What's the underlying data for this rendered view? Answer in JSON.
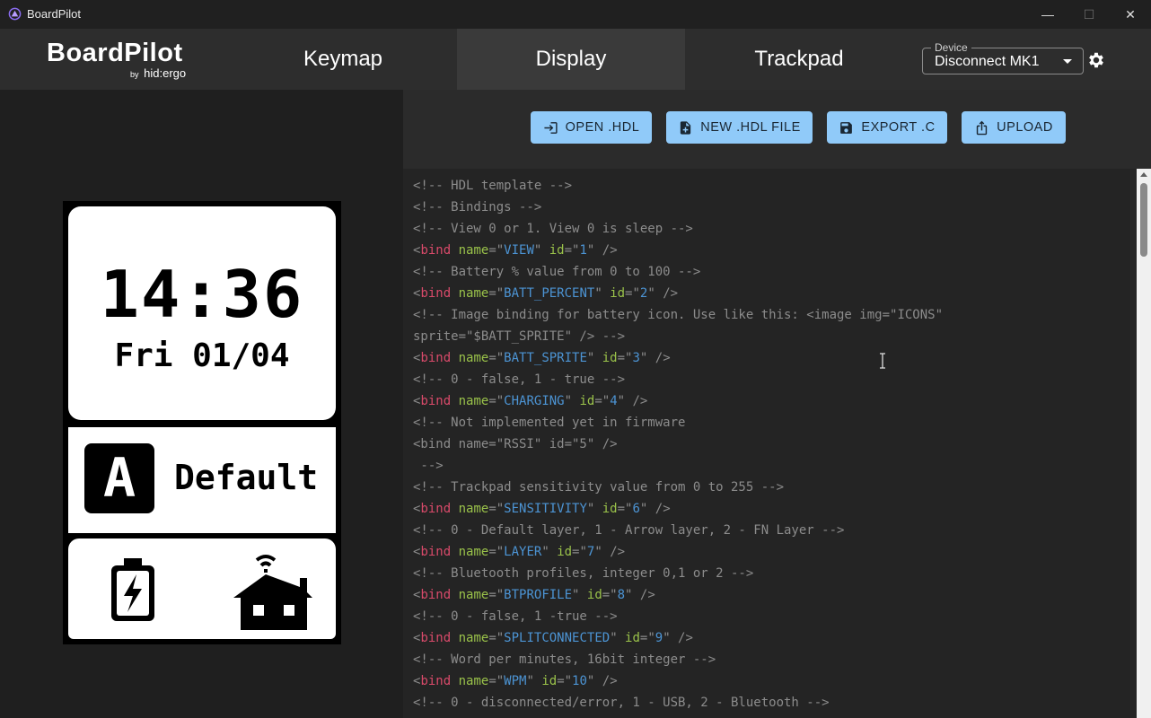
{
  "window": {
    "title": "BoardPilot",
    "minimize_glyph": "—",
    "maximize_glyph": "☐",
    "close_glyph": "✕"
  },
  "brand": {
    "name": "BoardPilot",
    "by": "by",
    "company": "hid:ergo"
  },
  "tabs": [
    {
      "label": "Keymap",
      "active": false
    },
    {
      "label": "Display",
      "active": true
    },
    {
      "label": "Trackpad",
      "active": false
    }
  ],
  "device": {
    "label": "Device",
    "value": "Disconnect MK1"
  },
  "toolbar": {
    "open_label": "OPEN .HDL",
    "new_label": "NEW .HDL FILE",
    "export_label": "EXPORT .C",
    "upload_label": "UPLOAD"
  },
  "preview": {
    "time": "14:36",
    "date": "Fri 01/04",
    "layer_letter": "A",
    "layer_name": "Default"
  },
  "colors": {
    "accent": "#90caf9",
    "tag": "#d94a6a",
    "attr": "#9ac24a",
    "string": "#4c94d4",
    "comment": "#8c8c8c"
  },
  "code_lines": [
    [
      [
        "c",
        "<!-- HDL template -->"
      ]
    ],
    [
      [
        "c",
        "<!-- Bindings -->"
      ]
    ],
    [
      [
        "c",
        "<!-- View 0 or 1. View 0 is sleep -->"
      ]
    ],
    [
      [
        "p",
        "<"
      ],
      [
        "t",
        "bind"
      ],
      [
        "p",
        " "
      ],
      [
        "a",
        "name"
      ],
      [
        "p",
        "=\""
      ],
      [
        "s",
        "VIEW"
      ],
      [
        "p",
        "\" "
      ],
      [
        "a",
        "id"
      ],
      [
        "p",
        "=\""
      ],
      [
        "s",
        "1"
      ],
      [
        "p",
        "\" />"
      ]
    ],
    [
      [
        "c",
        "<!-- Battery % value from 0 to 100 -->"
      ]
    ],
    [
      [
        "p",
        "<"
      ],
      [
        "t",
        "bind"
      ],
      [
        "p",
        " "
      ],
      [
        "a",
        "name"
      ],
      [
        "p",
        "=\""
      ],
      [
        "s",
        "BATT_PERCENT"
      ],
      [
        "p",
        "\" "
      ],
      [
        "a",
        "id"
      ],
      [
        "p",
        "=\""
      ],
      [
        "s",
        "2"
      ],
      [
        "p",
        "\" />"
      ]
    ],
    [
      [
        "c",
        "<!-- Image binding for battery icon. Use like this: <image img=\"ICONS\""
      ]
    ],
    [
      [
        "c",
        "sprite=\"$BATT_SPRITE\" /> -->"
      ]
    ],
    [
      [
        "p",
        "<"
      ],
      [
        "t",
        "bind"
      ],
      [
        "p",
        " "
      ],
      [
        "a",
        "name"
      ],
      [
        "p",
        "=\""
      ],
      [
        "s",
        "BATT_SPRITE"
      ],
      [
        "p",
        "\" "
      ],
      [
        "a",
        "id"
      ],
      [
        "p",
        "=\""
      ],
      [
        "s",
        "3"
      ],
      [
        "p",
        "\" />"
      ]
    ],
    [
      [
        "c",
        "<!-- 0 - false, 1 - true -->"
      ]
    ],
    [
      [
        "p",
        "<"
      ],
      [
        "t",
        "bind"
      ],
      [
        "p",
        " "
      ],
      [
        "a",
        "name"
      ],
      [
        "p",
        "=\""
      ],
      [
        "s",
        "CHARGING"
      ],
      [
        "p",
        "\" "
      ],
      [
        "a",
        "id"
      ],
      [
        "p",
        "=\""
      ],
      [
        "s",
        "4"
      ],
      [
        "p",
        "\" />"
      ]
    ],
    [
      [
        "c",
        "<!-- Not implemented yet in firmware"
      ]
    ],
    [
      [
        "c",
        "<bind name=\"RSSI\" id=\"5\" />"
      ]
    ],
    [
      [
        "c",
        " -->"
      ]
    ],
    [
      [
        "c",
        "<!-- Trackpad sensitivity value from 0 to 255 -->"
      ]
    ],
    [
      [
        "p",
        "<"
      ],
      [
        "t",
        "bind"
      ],
      [
        "p",
        " "
      ],
      [
        "a",
        "name"
      ],
      [
        "p",
        "=\""
      ],
      [
        "s",
        "SENSITIVITY"
      ],
      [
        "p",
        "\" "
      ],
      [
        "a",
        "id"
      ],
      [
        "p",
        "=\""
      ],
      [
        "s",
        "6"
      ],
      [
        "p",
        "\" />"
      ]
    ],
    [
      [
        "c",
        "<!-- 0 - Default layer, 1 - Arrow layer, 2 - FN Layer -->"
      ]
    ],
    [
      [
        "p",
        "<"
      ],
      [
        "t",
        "bind"
      ],
      [
        "p",
        " "
      ],
      [
        "a",
        "name"
      ],
      [
        "p",
        "=\""
      ],
      [
        "s",
        "LAYER"
      ],
      [
        "p",
        "\" "
      ],
      [
        "a",
        "id"
      ],
      [
        "p",
        "=\""
      ],
      [
        "s",
        "7"
      ],
      [
        "p",
        "\" />"
      ]
    ],
    [
      [
        "c",
        "<!-- Bluetooth profiles, integer 0,1 or 2 -->"
      ]
    ],
    [
      [
        "p",
        "<"
      ],
      [
        "t",
        "bind"
      ],
      [
        "p",
        " "
      ],
      [
        "a",
        "name"
      ],
      [
        "p",
        "=\""
      ],
      [
        "s",
        "BTPROFILE"
      ],
      [
        "p",
        "\" "
      ],
      [
        "a",
        "id"
      ],
      [
        "p",
        "=\""
      ],
      [
        "s",
        "8"
      ],
      [
        "p",
        "\" />"
      ]
    ],
    [
      [
        "c",
        "<!-- 0 - false, 1 -true -->"
      ]
    ],
    [
      [
        "p",
        "<"
      ],
      [
        "t",
        "bind"
      ],
      [
        "p",
        " "
      ],
      [
        "a",
        "name"
      ],
      [
        "p",
        "=\""
      ],
      [
        "s",
        "SPLITCONNECTED"
      ],
      [
        "p",
        "\" "
      ],
      [
        "a",
        "id"
      ],
      [
        "p",
        "=\""
      ],
      [
        "s",
        "9"
      ],
      [
        "p",
        "\" />"
      ]
    ],
    [
      [
        "c",
        "<!-- Word per minutes, 16bit integer -->"
      ]
    ],
    [
      [
        "p",
        "<"
      ],
      [
        "t",
        "bind"
      ],
      [
        "p",
        " "
      ],
      [
        "a",
        "name"
      ],
      [
        "p",
        "=\""
      ],
      [
        "s",
        "WPM"
      ],
      [
        "p",
        "\" "
      ],
      [
        "a",
        "id"
      ],
      [
        "p",
        "=\""
      ],
      [
        "s",
        "10"
      ],
      [
        "p",
        "\" />"
      ]
    ],
    [
      [
        "c",
        "<!-- 0 - disconnected/error, 1 - USB, 2 - Bluetooth -->"
      ]
    ]
  ]
}
